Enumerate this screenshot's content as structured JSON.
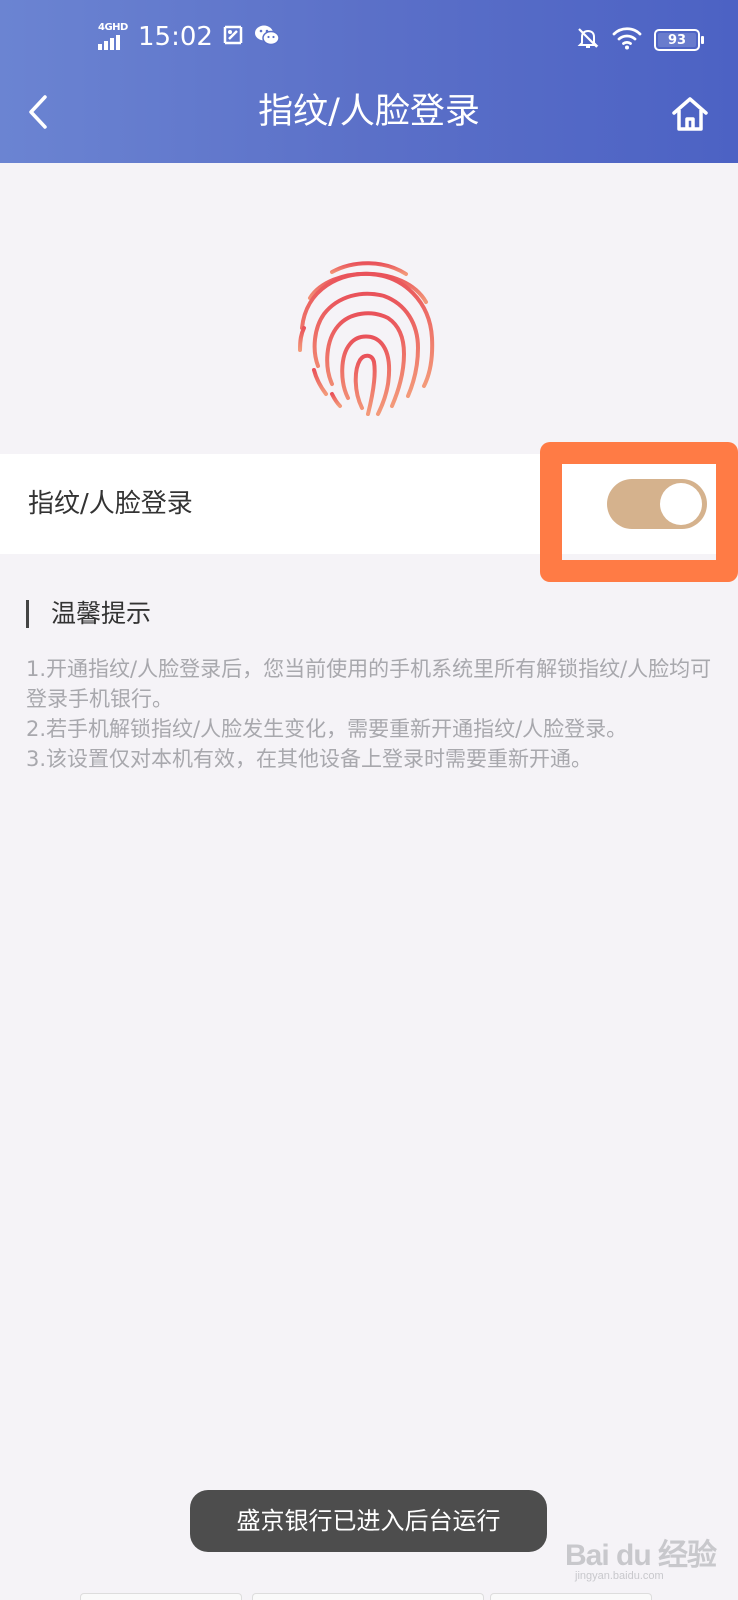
{
  "status_bar": {
    "network": "4GHD",
    "time": "15:02",
    "battery_level": "93",
    "icons": [
      "signal-icon",
      "screenshot-notify-icon",
      "wechat-icon",
      "mute-bell-icon",
      "wifi-icon",
      "battery-icon"
    ]
  },
  "header": {
    "title": "指纹/人脸登录",
    "back_icon": "chevron-left-icon",
    "home_icon": "home-icon"
  },
  "fingerprint": {
    "icon": "fingerprint-icon",
    "colors": {
      "top": "#e9525a",
      "bottom": "#f39a7a"
    }
  },
  "setting": {
    "label": "指纹/人脸登录",
    "toggle_on": true,
    "toggle_color": "#d5b28d",
    "highlight_color": "#ff7b45"
  },
  "tips": {
    "title": "温馨提示",
    "lines": [
      "1.开通指纹/人脸登录后，您当前使用的手机系统里所有解锁指纹/人脸均可登录手机银行。",
      "2.若手机解锁指纹/人脸发生变化，需要重新开通指纹/人脸登录。",
      "3.该设置仅对本机有效，在其他设备上登录时需要重新开通。"
    ]
  },
  "toast": {
    "text": "盛京银行已进入后台运行"
  },
  "watermark": {
    "main": "Bai du 经验",
    "sub": "jingyan.baidu.com"
  }
}
